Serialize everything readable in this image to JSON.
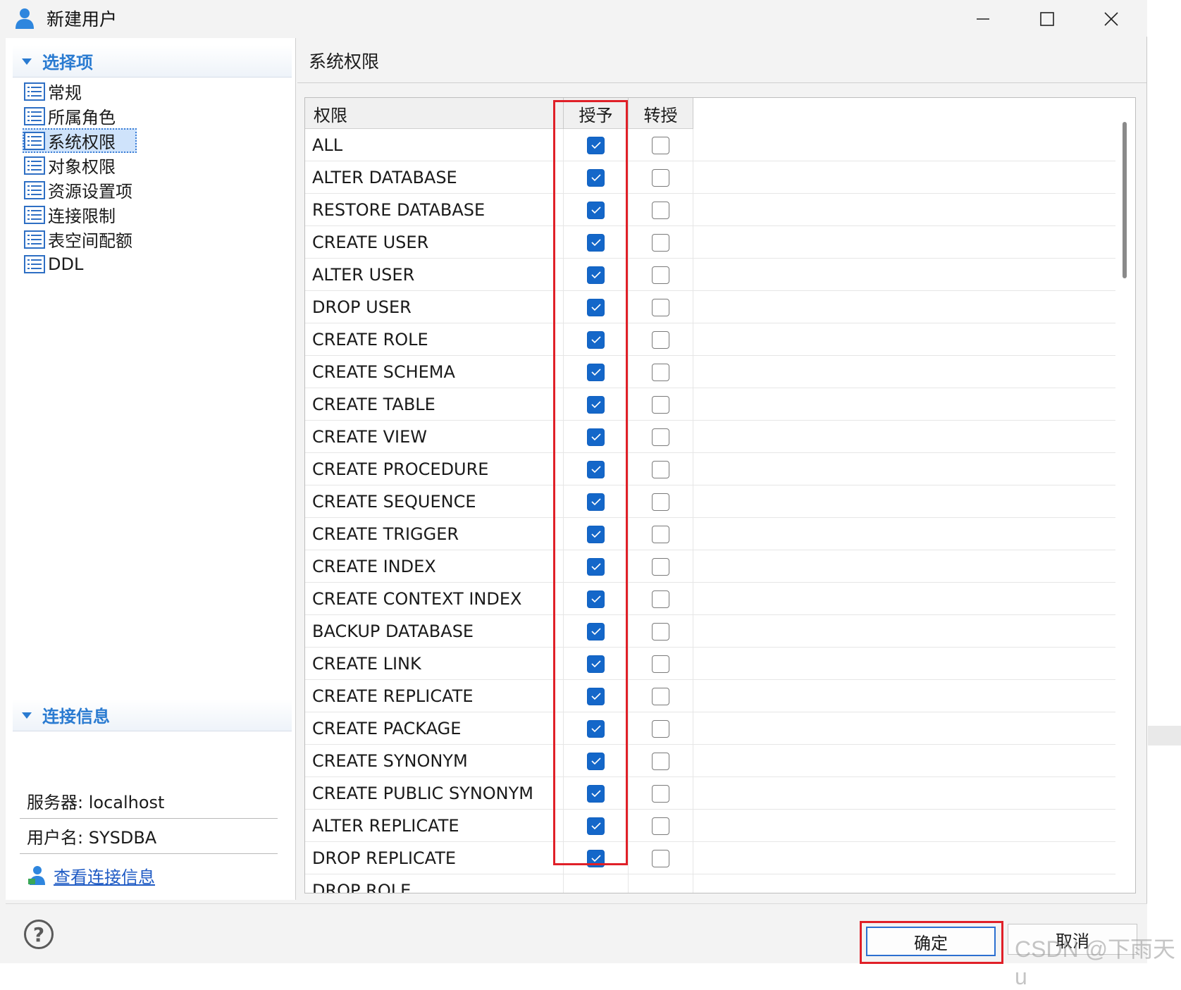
{
  "window": {
    "title": "新建用户",
    "icons": {
      "app": "user-icon",
      "minimize": "minimize-icon",
      "maximize": "maximize-icon",
      "close": "close-icon"
    }
  },
  "sidebar": {
    "options_header": "选择项",
    "items": [
      {
        "label": "常规",
        "icon": "list-icon",
        "selected": false
      },
      {
        "label": "所属角色",
        "icon": "list-icon",
        "selected": false
      },
      {
        "label": "系统权限",
        "icon": "list-icon",
        "selected": true
      },
      {
        "label": "对象权限",
        "icon": "list-icon",
        "selected": false
      },
      {
        "label": "资源设置项",
        "icon": "list-icon",
        "selected": false
      },
      {
        "label": "连接限制",
        "icon": "list-icon",
        "selected": false
      },
      {
        "label": "表空间配额",
        "icon": "list-icon",
        "selected": false
      },
      {
        "label": "DDL",
        "icon": "list-icon",
        "selected": false
      }
    ],
    "conn_header": "连接信息",
    "server": "服务器: localhost",
    "username": "用户名: SYSDBA",
    "view_conn_link": "查看连接信息"
  },
  "main": {
    "section_title": "系统权限",
    "columns": [
      "权限",
      "授予",
      "转授"
    ],
    "rows": [
      {
        "privilege": "ALL",
        "grant": true,
        "regrant": false
      },
      {
        "privilege": "ALTER DATABASE",
        "grant": true,
        "regrant": false
      },
      {
        "privilege": "RESTORE DATABASE",
        "grant": true,
        "regrant": false
      },
      {
        "privilege": "CREATE USER",
        "grant": true,
        "regrant": false
      },
      {
        "privilege": "ALTER USER",
        "grant": true,
        "regrant": false
      },
      {
        "privilege": "DROP USER",
        "grant": true,
        "regrant": false
      },
      {
        "privilege": "CREATE ROLE",
        "grant": true,
        "regrant": false
      },
      {
        "privilege": "CREATE SCHEMA",
        "grant": true,
        "regrant": false
      },
      {
        "privilege": "CREATE TABLE",
        "grant": true,
        "regrant": false
      },
      {
        "privilege": "CREATE VIEW",
        "grant": true,
        "regrant": false
      },
      {
        "privilege": "CREATE PROCEDURE",
        "grant": true,
        "regrant": false
      },
      {
        "privilege": "CREATE SEQUENCE",
        "grant": true,
        "regrant": false
      },
      {
        "privilege": "CREATE TRIGGER",
        "grant": true,
        "regrant": false
      },
      {
        "privilege": "CREATE INDEX",
        "grant": true,
        "regrant": false
      },
      {
        "privilege": "CREATE CONTEXT INDEX",
        "grant": true,
        "regrant": false
      },
      {
        "privilege": "BACKUP DATABASE",
        "grant": true,
        "regrant": false
      },
      {
        "privilege": "CREATE LINK",
        "grant": true,
        "regrant": false
      },
      {
        "privilege": "CREATE REPLICATE",
        "grant": true,
        "regrant": false
      },
      {
        "privilege": "CREATE PACKAGE",
        "grant": true,
        "regrant": false
      },
      {
        "privilege": "CREATE SYNONYM",
        "grant": true,
        "regrant": false
      },
      {
        "privilege": "CREATE PUBLIC SYNONYM",
        "grant": true,
        "regrant": false
      },
      {
        "privilege": "ALTER REPLICATE",
        "grant": true,
        "regrant": false
      },
      {
        "privilege": "DROP REPLICATE",
        "grant": true,
        "regrant": false
      },
      {
        "privilege": "DROP ROLE",
        "grant": false,
        "regrant": false
      }
    ]
  },
  "footer": {
    "help_icon": "help-icon",
    "help_glyph": "?",
    "ok_label": "确定",
    "cancel_label": "取消"
  },
  "watermark": "CSDN @下雨天u",
  "colors": {
    "accent": "#1467c9",
    "highlight": "#e02028",
    "header_text": "#2a7bd1"
  }
}
